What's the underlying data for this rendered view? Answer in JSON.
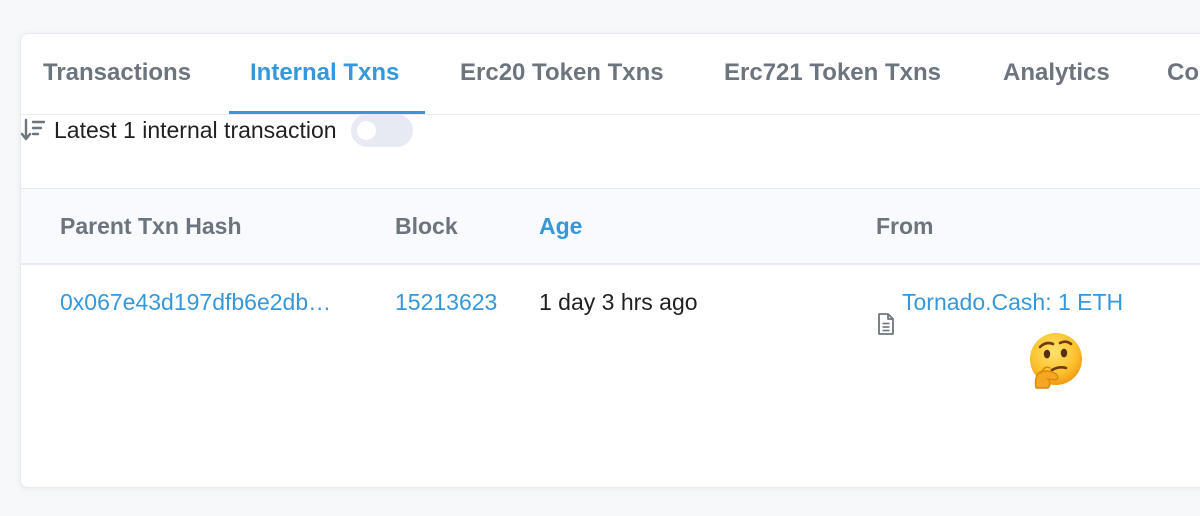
{
  "tabs": [
    {
      "label": "Transactions",
      "active": false
    },
    {
      "label": "Internal Txns",
      "active": true
    },
    {
      "label": "Erc20 Token Txns",
      "active": false
    },
    {
      "label": "Erc721 Token Txns",
      "active": false
    },
    {
      "label": "Analytics",
      "active": false
    },
    {
      "label": "Co",
      "active": false
    }
  ],
  "summary": {
    "icon": "sort-descending-icon",
    "text": "Latest 1 internal transaction",
    "toggle_on": false
  },
  "table": {
    "headers": [
      "Parent Txn Hash",
      "Block",
      "Age",
      "From"
    ],
    "rows": [
      {
        "parent_txn_hash": "0x067e43d197dfb6e2db…",
        "block": "15213623",
        "age": "1 day 3 hrs ago",
        "from": "Tornado.Cash: 1 ETH",
        "from_icon": "contract-document-icon"
      }
    ]
  },
  "overlay": {
    "emoji": "thinking-face-emoji"
  },
  "colors": {
    "accent": "#3498db",
    "muted": "#6c757e",
    "text": "#1e2022",
    "border": "#e7eaf3"
  }
}
